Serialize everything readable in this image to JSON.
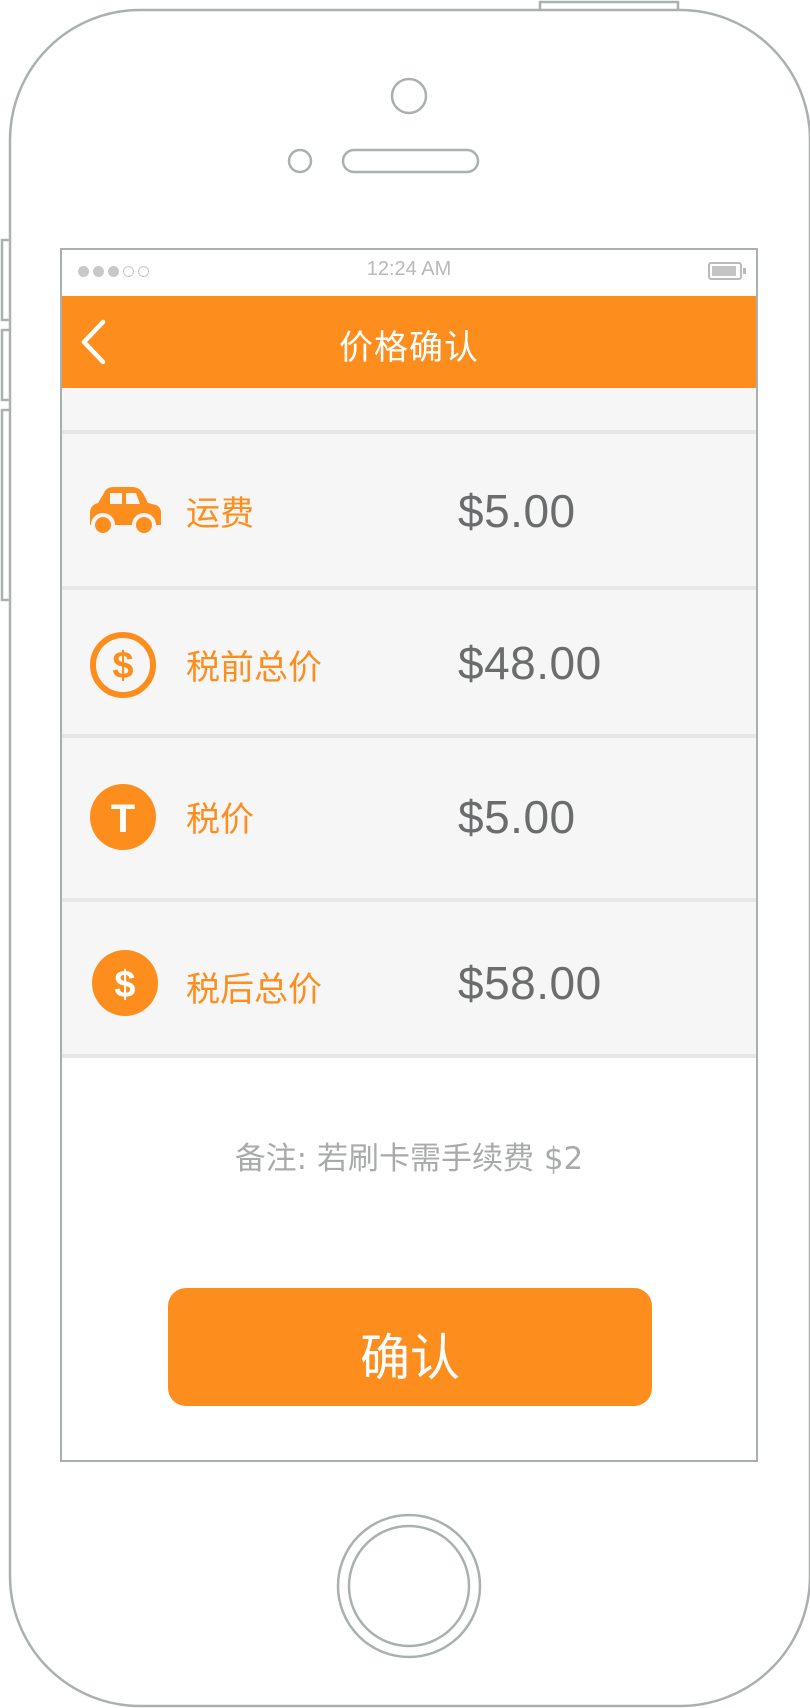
{
  "status_bar": {
    "time": "12:24 AM"
  },
  "header": {
    "title": "价格确认",
    "back_icon": "chevron-left-icon"
  },
  "price_items": [
    {
      "icon": "car-icon",
      "label": "运费",
      "value": "$5.00"
    },
    {
      "icon": "dollar-circle-outline-icon",
      "label": "税前总价",
      "value": "$48.00"
    },
    {
      "icon": "tax-t-icon",
      "label": "税价",
      "value": "$5.00"
    },
    {
      "icon": "dollar-circle-icon",
      "label": "税后总价",
      "value": "$58.00"
    }
  ],
  "note": "备注: 若刷卡需手续费 $2",
  "confirm_button": {
    "label": "确认"
  },
  "colors": {
    "accent": "#fd8e1e",
    "row_background": "#f5f6f5",
    "divider": "#e6e8e7",
    "value_text": "#6b6c6d",
    "note_text": "#a9abab",
    "frame_outline": "#aab0b0"
  }
}
